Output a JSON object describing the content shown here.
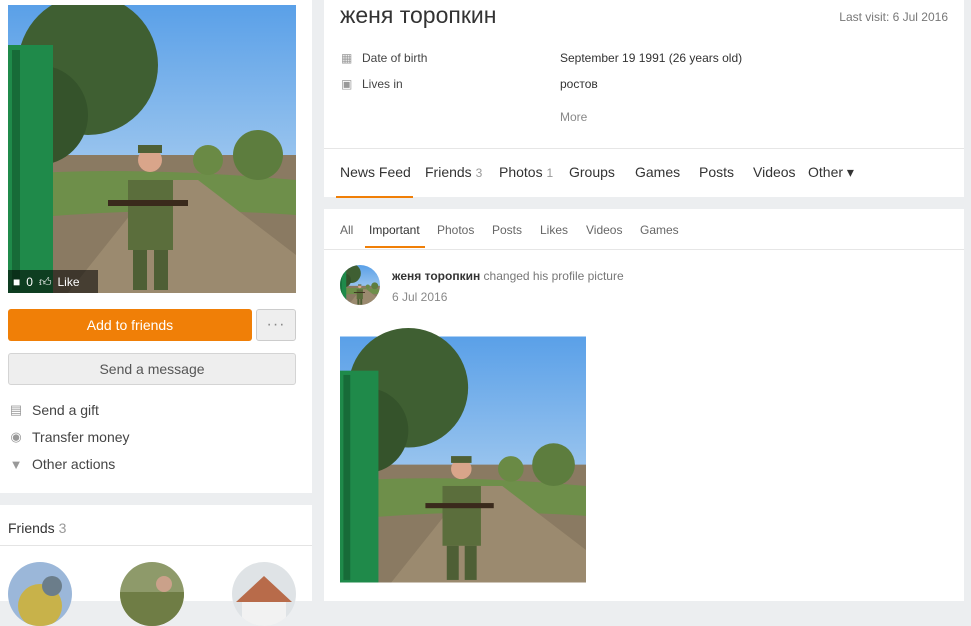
{
  "profile": {
    "name": "женя торопкин",
    "last_visit": "Last visit: 6 Jul 2016",
    "photo": {
      "comments": "0",
      "like_label": "Like"
    },
    "info": [
      {
        "icon": "calendar-icon",
        "label": "Date of birth",
        "value": "September 19 1991 (26 years old)"
      },
      {
        "icon": "buildings-icon",
        "label": "Lives in",
        "value": "ростов"
      }
    ],
    "more_label": "More"
  },
  "actions": {
    "add_friends": "Add to friends",
    "more_dots": "···",
    "send_message": "Send a message",
    "list": [
      {
        "icon": "gift-icon",
        "label": "Send a gift"
      },
      {
        "icon": "ruble-icon",
        "label": "Transfer money"
      },
      {
        "icon": "caret-down-icon",
        "label": "Other actions"
      }
    ]
  },
  "friends": {
    "title": "Friends",
    "count": "3"
  },
  "tabs": [
    {
      "label": "News Feed",
      "count": ""
    },
    {
      "label": "Friends",
      "count": "3"
    },
    {
      "label": "Photos",
      "count": "1"
    },
    {
      "label": "Groups",
      "count": ""
    },
    {
      "label": "Games",
      "count": ""
    },
    {
      "label": "Posts",
      "count": ""
    },
    {
      "label": "Videos",
      "count": ""
    },
    {
      "label": "Other ▾",
      "count": ""
    }
  ],
  "feed_tabs": [
    "All",
    "Important",
    "Photos",
    "Posts",
    "Likes",
    "Videos",
    "Games"
  ],
  "post": {
    "author": "женя торопкин",
    "action": "changed his profile picture",
    "date": "6 Jul 2016"
  },
  "colors": {
    "accent": "#f07f07",
    "background": "#eceef0"
  }
}
